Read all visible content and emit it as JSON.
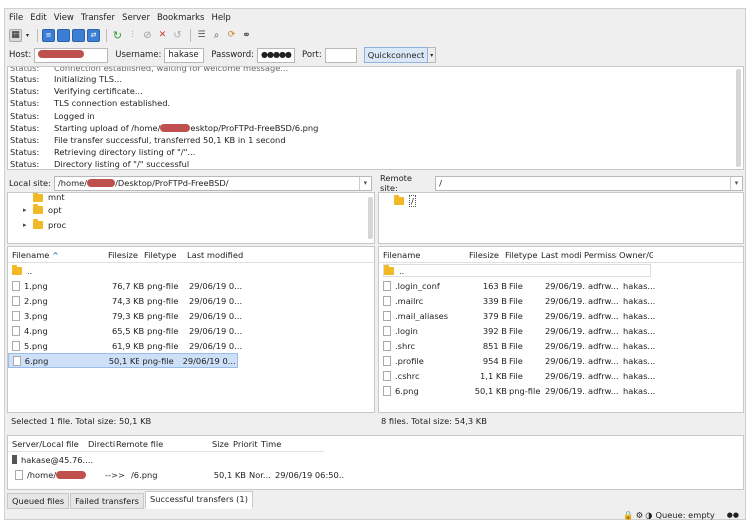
{
  "menu": [
    "File",
    "Edit",
    "View",
    "Transfer",
    "Server",
    "Bookmarks",
    "Help"
  ],
  "toolbar_icons": [
    "site-manager",
    "toggle-log",
    "toggle-local-tree",
    "toggle-remote-tree",
    "toggle-queue",
    "refresh",
    "process-queue",
    "cancel",
    "disconnect",
    "reconnect",
    "directory-listing-filter",
    "compare",
    "sync-browse",
    "search"
  ],
  "quickconnect": {
    "host_label": "Host:",
    "username_label": "Username:",
    "username_value": "hakase",
    "password_label": "Password:",
    "password_value": "●●●●●",
    "port_label": "Port:",
    "port_value": "",
    "button_label": "Quickconnect"
  },
  "log": [
    {
      "k": "Status:",
      "v": "Initializing TLS..."
    },
    {
      "k": "Status:",
      "v": "Verifying certificate..."
    },
    {
      "k": "Status:",
      "v": "TLS connection established."
    },
    {
      "k": "Status:",
      "v": "Logged in"
    },
    {
      "k": "Status:",
      "v": "Starting upload of /home/",
      "v2": "esktop/ProFTPd-FreeBSD/6.png"
    },
    {
      "k": "Status:",
      "v": "File transfer successful, transferred 50,1 KB in 1 second"
    },
    {
      "k": "Status:",
      "v": "Retrieving directory listing of \"/\"..."
    },
    {
      "k": "Status:",
      "v": "Directory listing of \"/\" successful"
    }
  ],
  "local": {
    "label": "Local site:",
    "path_prefix": "/home/",
    "path_suffix": "/Desktop/ProFTPd-FreeBSD/",
    "tree": [
      {
        "name": "mnt",
        "expander": ""
      },
      {
        "name": "opt",
        "expander": "▸"
      },
      {
        "name": "proc",
        "expander": "▸"
      }
    ],
    "columns": [
      "Filename",
      "Filesize",
      "Filetype",
      "Last modified"
    ],
    "sort_indicator": "^",
    "parent": "..",
    "files": [
      {
        "name": "1.png",
        "size": "76,7 KB",
        "type": "png-file",
        "mod": "29/06/19 0..."
      },
      {
        "name": "2.png",
        "size": "74,3 KB",
        "type": "png-file",
        "mod": "29/06/19 0..."
      },
      {
        "name": "3.png",
        "size": "79,3 KB",
        "type": "png-file",
        "mod": "29/06/19 0..."
      },
      {
        "name": "4.png",
        "size": "65,5 KB",
        "type": "png-file",
        "mod": "29/06/19 0..."
      },
      {
        "name": "5.png",
        "size": "61,9 KB",
        "type": "png-file",
        "mod": "29/06/19 0..."
      },
      {
        "name": "6.png",
        "size": "50,1 KB",
        "type": "png-file",
        "mod": "29/06/19 0..."
      }
    ],
    "status": "Selected 1 file. Total size: 50,1 KB"
  },
  "remote": {
    "label": "Remote site:",
    "path": "/",
    "tree_root": "/",
    "columns": [
      "Filename",
      "Filesize",
      "Filetype",
      "Last modifi",
      "Permissi",
      "Owner/G"
    ],
    "parent": "..",
    "files": [
      {
        "name": ".login_conf",
        "size": "163 B",
        "type": "File",
        "mod": "29/06/19...",
        "perm": "adfrw...",
        "owner": "hakas..."
      },
      {
        "name": ".mailrc",
        "size": "339 B",
        "type": "File",
        "mod": "29/06/19...",
        "perm": "adfrw...",
        "owner": "hakas..."
      },
      {
        "name": ".mail_aliases",
        "size": "379 B",
        "type": "File",
        "mod": "29/06/19...",
        "perm": "adfrw...",
        "owner": "hakas..."
      },
      {
        "name": ".login",
        "size": "392 B",
        "type": "File",
        "mod": "29/06/19...",
        "perm": "adfrw...",
        "owner": "hakas..."
      },
      {
        "name": ".shrc",
        "size": "851 B",
        "type": "File",
        "mod": "29/06/19...",
        "perm": "adfrw...",
        "owner": "hakas..."
      },
      {
        "name": ".profile",
        "size": "954 B",
        "type": "File",
        "mod": "29/06/19...",
        "perm": "adfrw...",
        "owner": "hakas..."
      },
      {
        "name": ".cshrc",
        "size": "1,1 KB",
        "type": "File",
        "mod": "29/06/19...",
        "perm": "adfrw...",
        "owner": "hakas..."
      },
      {
        "name": "6.png",
        "size": "50,1 KB",
        "type": "png-file",
        "mod": "29/06/19...",
        "perm": "adfrw...",
        "owner": "hakas..."
      }
    ],
    "status": "8 files. Total size: 54,3 KB"
  },
  "queue": {
    "columns": [
      "Server/Local file",
      "Directi",
      "Remote file",
      "Size",
      "Priorit",
      "Time"
    ],
    "server": "hakase@45.76....",
    "row": {
      "local_prefix": "/home/",
      "direction": "-->>",
      "remote": "/6.png",
      "size": "50,1 KB",
      "priority": "Nor...",
      "time": "29/06/19 06:50..."
    },
    "tabs": [
      "Queued files",
      "Failed transfers",
      "Successful transfers (1)"
    ],
    "status": "Queue: empty"
  }
}
